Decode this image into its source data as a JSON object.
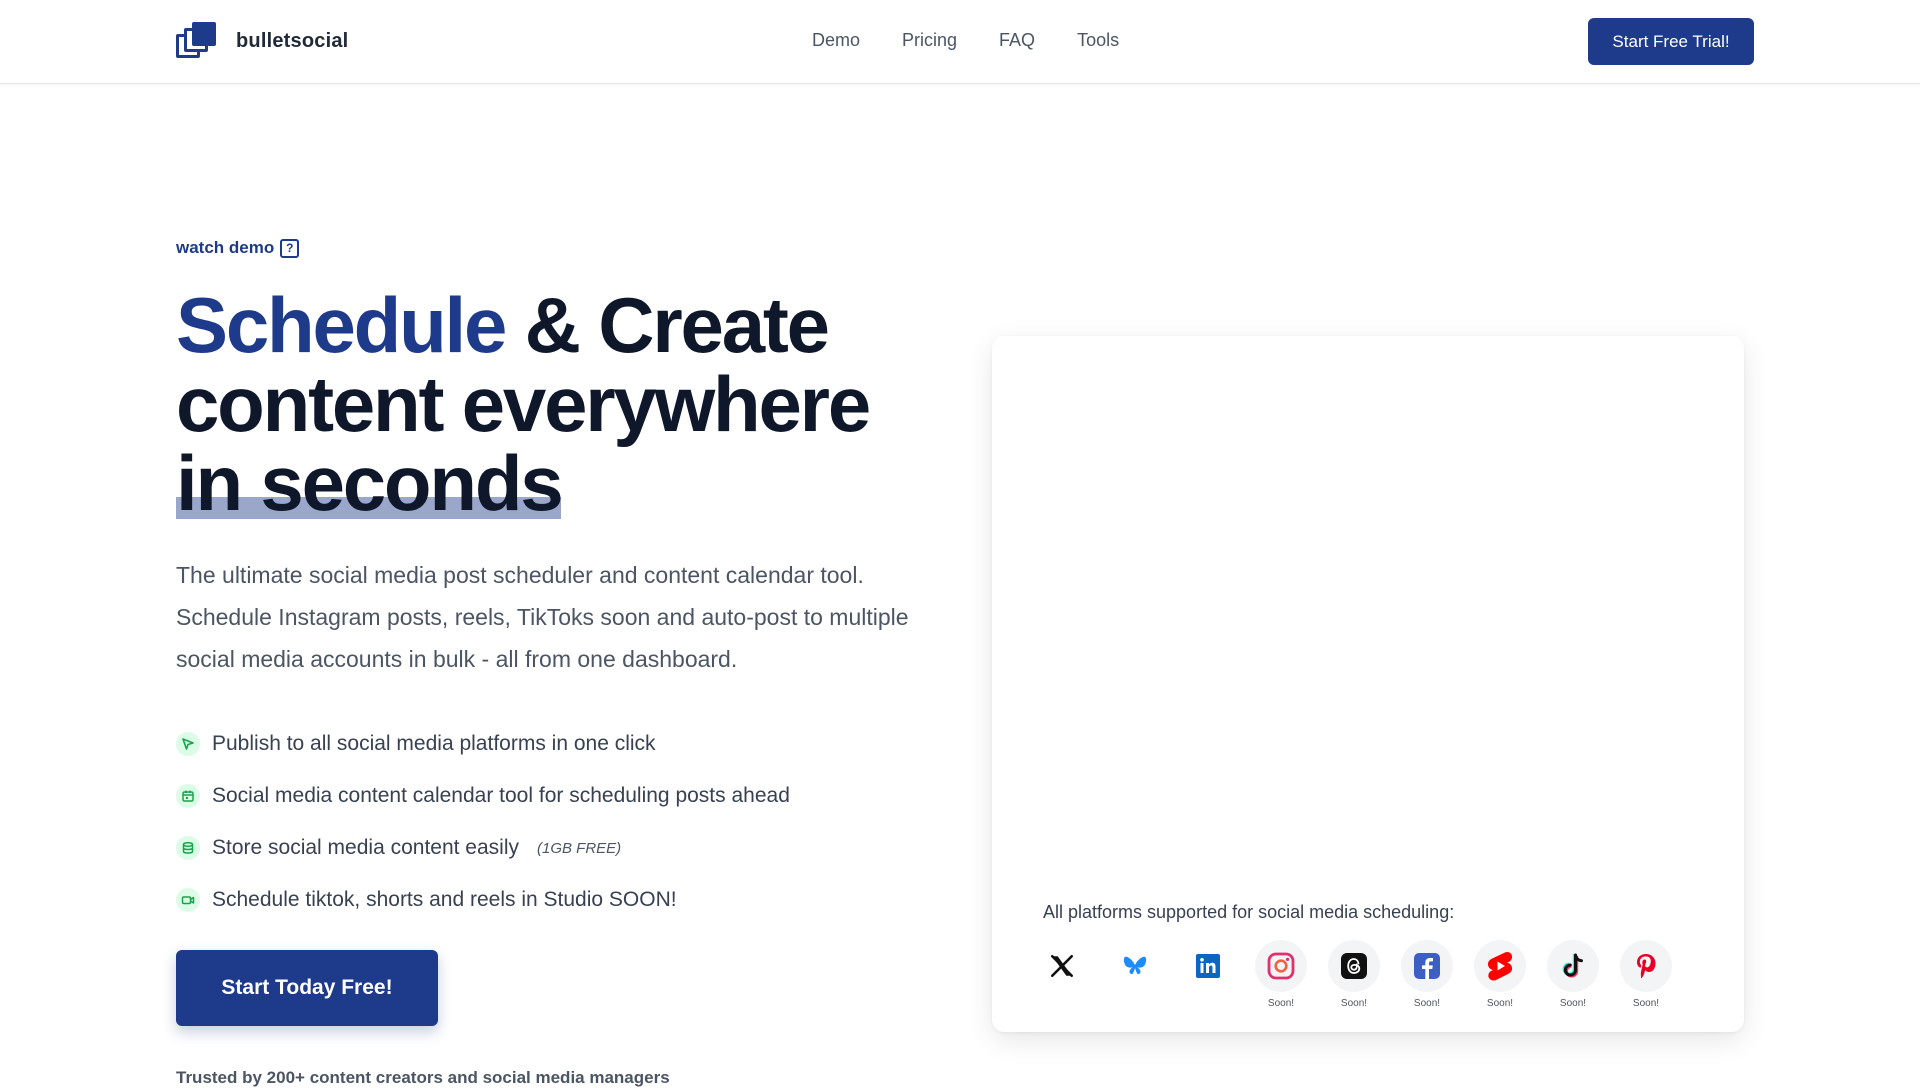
{
  "nav": {
    "brand": "bulletsocial",
    "links": [
      "Demo",
      "Pricing",
      "FAQ",
      "Tools"
    ],
    "cta": "Start Free Trial!"
  },
  "hero": {
    "watch_demo": "watch demo",
    "headline_accent": "Schedule",
    "headline_rest": " & Create content everywhere",
    "headline_highlight": "in seconds",
    "subtext": "The ultimate social media post scheduler and content calendar tool. Schedule Instagram posts, reels, TikToks soon and auto-post to multiple social media accounts in bulk - all from one dashboard.",
    "features": [
      {
        "text": "Publish to all social media platforms in one click",
        "icon": "cursor-icon"
      },
      {
        "text": "Social media content calendar tool for scheduling posts ahead",
        "icon": "calendar-icon"
      },
      {
        "text": "Store social media content easily",
        "icon": "database-icon",
        "note": "(1GB FREE)"
      },
      {
        "text": "Schedule tiktok, shorts and reels in Studio SOON!",
        "icon": "video-icon"
      }
    ],
    "cta": "Start Today Free!",
    "trusted": "Trusted by 200+ content creators and social media managers"
  },
  "card": {
    "platforms_label": "All platforms supported for social media scheduling:",
    "platforms": [
      {
        "name": "X",
        "icon": "x-icon",
        "soon": ""
      },
      {
        "name": "Bluesky",
        "icon": "bluesky-icon",
        "soon": ""
      },
      {
        "name": "LinkedIn",
        "icon": "linkedin-icon",
        "soon": ""
      },
      {
        "name": "Instagram",
        "icon": "instagram-icon",
        "soon": "Soon!"
      },
      {
        "name": "Threads",
        "icon": "threads-icon",
        "soon": "Soon!"
      },
      {
        "name": "Facebook",
        "icon": "facebook-icon",
        "soon": "Soon!"
      },
      {
        "name": "YouTube Shorts",
        "icon": "youtube-shorts-icon",
        "soon": "Soon!"
      },
      {
        "name": "TikTok",
        "icon": "tiktok-icon",
        "soon": "Soon!"
      },
      {
        "name": "Pinterest",
        "icon": "pinterest-icon",
        "soon": "Soon!"
      }
    ]
  },
  "colors": {
    "brand": "#1e3a8a",
    "heading": "#0f172a",
    "body_text": "#4b5563",
    "feature_icon_bg": "#dcfce7",
    "feature_icon_fg": "#16a34a"
  }
}
